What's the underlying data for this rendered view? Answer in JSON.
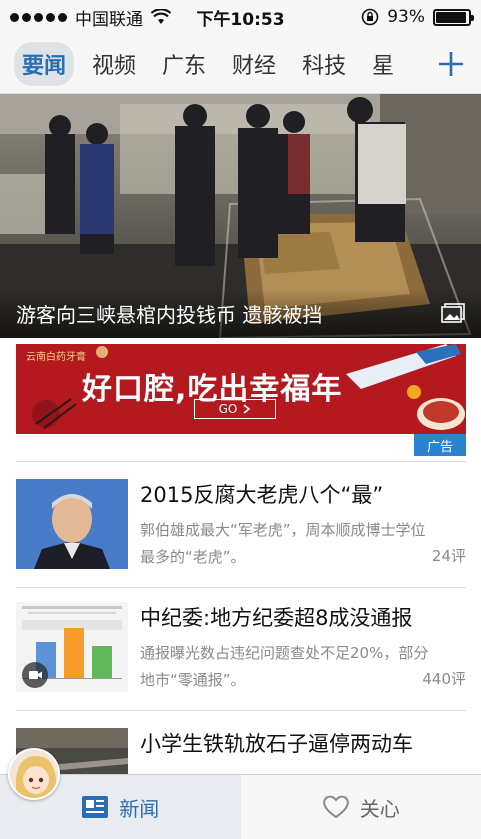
{
  "status_bar": {
    "carrier": "中国联通",
    "time": "下午10:53",
    "battery": "93%",
    "battery_level": 0.93
  },
  "channels": [
    {
      "label": "要闻",
      "active": true
    },
    {
      "label": "视频"
    },
    {
      "label": "广东"
    },
    {
      "label": "财经"
    },
    {
      "label": "科技"
    },
    {
      "label": "星"
    }
  ],
  "hero": {
    "title": "游客向三峡悬棺内投钱币 遗骸被挡"
  },
  "ad": {
    "brand": "云南白药牙膏",
    "slogan": "好口腔,吃出幸福年",
    "button": "GO",
    "badge": "广告"
  },
  "news": [
    {
      "title": "2015反腐大老虎八个“最”",
      "summary": "郭伯雄成最大“军老虎”，周本顺成博士学位最多的“老虎”。",
      "comments": "24评"
    },
    {
      "title": "中纪委:地方纪委超8成没通报",
      "summary": "通报曝光数占违纪问题查处不足20%，部分地市“零通报”。",
      "comments": "440评"
    },
    {
      "title": "小学生铁轨放石子逼停两动车",
      "summary": "",
      "comments": ""
    }
  ],
  "tab_bar": {
    "news_label": "新闻",
    "follow_label": "关心"
  },
  "colors": {
    "accent": "#2a6db3",
    "ad_red": "#b3191f",
    "ad_badge": "#2b82d0"
  }
}
